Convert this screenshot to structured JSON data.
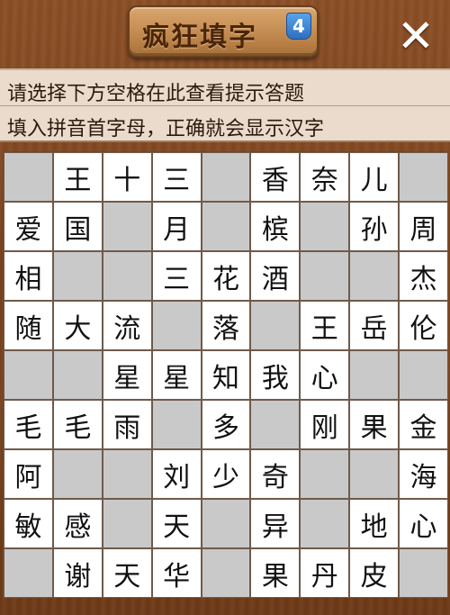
{
  "header": {
    "title": "疯狂填字",
    "level": "4",
    "close_label": "✕"
  },
  "hints": {
    "line1": "请选择下方空格在此查看提示答题",
    "line2": "填入拼音首字母，正确就会显示汉字"
  },
  "grid": {
    "rows": [
      [
        "",
        "王",
        "十",
        "三",
        "",
        "香",
        "奈",
        "儿",
        ""
      ],
      [
        "爱",
        "国",
        "",
        "月",
        "",
        "槟",
        "",
        "孙",
        "周"
      ],
      [
        "相",
        "",
        "",
        "三",
        "花",
        "酒",
        "",
        "",
        "杰"
      ],
      [
        "随",
        "大",
        "流",
        "",
        "落",
        "",
        "王",
        "岳",
        "伦"
      ],
      [
        "",
        "",
        "星",
        "星",
        "知",
        "我",
        "心",
        "",
        ""
      ],
      [
        "毛",
        "毛",
        "雨",
        "",
        "多",
        "",
        "刚",
        "果",
        "金"
      ],
      [
        "阿",
        "",
        "",
        "刘",
        "少",
        "奇",
        "",
        "",
        "海"
      ],
      [
        "敏",
        "感",
        "",
        "天",
        "",
        "异",
        "",
        "地",
        "心"
      ],
      [
        "",
        "谢",
        "天",
        "华",
        "",
        "果",
        "丹",
        "皮",
        ""
      ]
    ]
  },
  "colors": {
    "blank_cell": "#c9c9c9",
    "letter_cell": "#ffffff",
    "background": "#7a421d"
  }
}
